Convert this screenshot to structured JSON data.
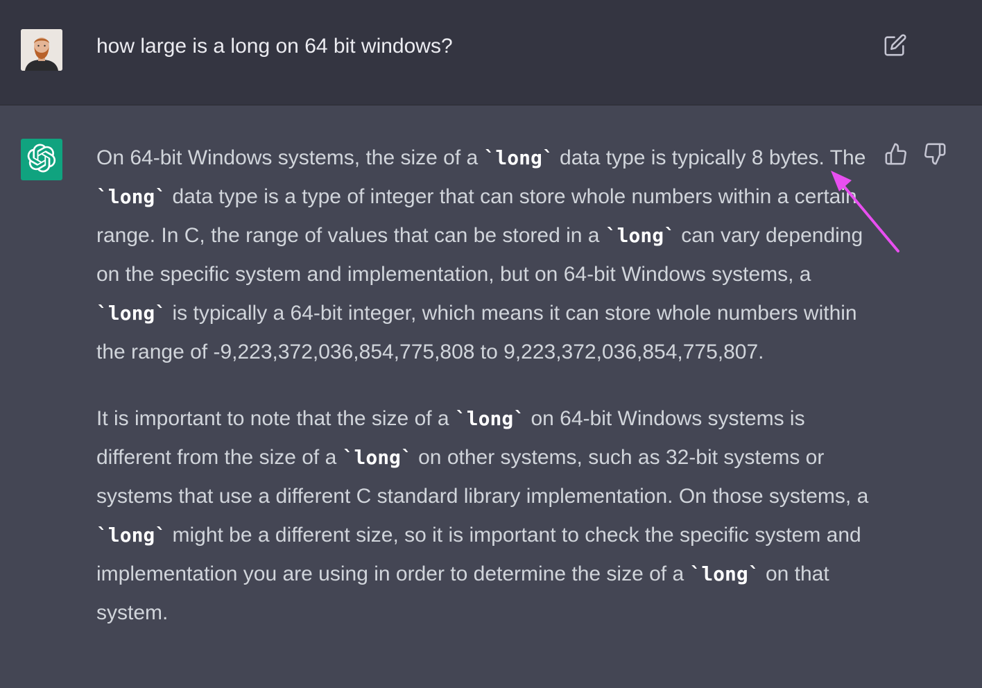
{
  "user_message": {
    "text": "how large is a long on 64 bit windows?"
  },
  "assistant_message": {
    "p1": [
      "On 64-bit Windows systems, the size of a ",
      "`long`",
      " data type is typically 8 bytes. The ",
      "`long`",
      " data type is a type of integer that can store whole numbers within a certain range. In C, the range of values that can be stored in a ",
      "`long`",
      " can vary depending on the specific system and implementation, but on 64-bit Windows systems, a ",
      "`long`",
      " is typically a 64-bit integer, which means it can store whole numbers within the range of -9,223,372,036,854,775,808 to 9,223,372,036,854,775,807."
    ],
    "p2": [
      "It is important to note that the size of a ",
      "`long`",
      " on 64-bit Windows systems is different from the size of a ",
      "`long`",
      " on other systems, such as 32-bit systems or systems that use a different C standard library implementation. On those systems, a ",
      "`long`",
      " might be a different size, so it is important to check the specific system and implementation you are using in order to determine the size of a ",
      "`long`",
      " on that system."
    ]
  },
  "icons": {
    "edit": "edit-icon",
    "thumbs_up": "thumbs-up-icon",
    "thumbs_down": "thumbs-down-icon",
    "bot_logo": "openai-logo-icon"
  },
  "colors": {
    "user_bg": "#343541",
    "assistant_bg": "#444654",
    "bot_avatar": "#10a37f",
    "annotation_arrow": "#e84ff0"
  }
}
